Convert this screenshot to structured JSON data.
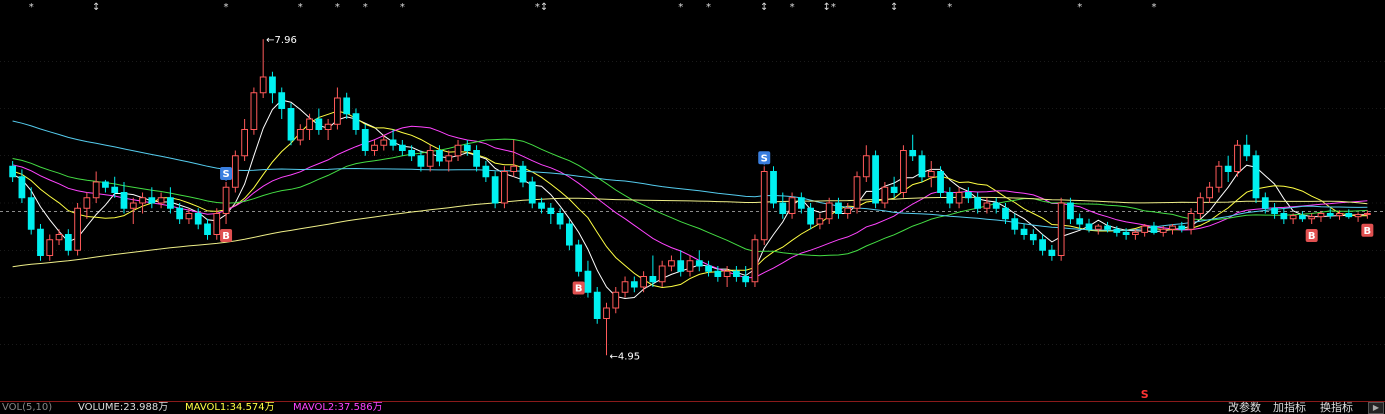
{
  "chart_data": {
    "type": "candlestick",
    "price_range": [
      4.6,
      8.2
    ],
    "reference_price": 6.32,
    "price_high_label": "7.96",
    "price_low_label": "4.95",
    "candles": [
      [
        6.75,
        6.8,
        6.6,
        6.65
      ],
      [
        6.65,
        6.72,
        6.4,
        6.45
      ],
      [
        6.45,
        6.55,
        6.1,
        6.15
      ],
      [
        6.15,
        6.2,
        5.85,
        5.9
      ],
      [
        5.9,
        6.1,
        5.85,
        6.05
      ],
      [
        6.05,
        6.15,
        6.0,
        6.1
      ],
      [
        6.1,
        6.15,
        5.9,
        5.95
      ],
      [
        5.95,
        6.4,
        5.9,
        6.35
      ],
      [
        6.35,
        6.5,
        6.25,
        6.45
      ],
      [
        6.45,
        6.7,
        6.4,
        6.6
      ],
      [
        6.6,
        6.62,
        6.5,
        6.55
      ],
      [
        6.55,
        6.65,
        6.45,
        6.5
      ],
      [
        6.5,
        6.6,
        6.3,
        6.35
      ],
      [
        6.35,
        6.45,
        6.2,
        6.4
      ],
      [
        6.4,
        6.5,
        6.3,
        6.45
      ],
      [
        6.45,
        6.55,
        6.35,
        6.4
      ],
      [
        6.4,
        6.5,
        6.35,
        6.45
      ],
      [
        6.45,
        6.55,
        6.3,
        6.35
      ],
      [
        6.35,
        6.4,
        6.2,
        6.25
      ],
      [
        6.25,
        6.35,
        6.2,
        6.3
      ],
      [
        6.3,
        6.35,
        6.15,
        6.2
      ],
      [
        6.2,
        6.25,
        6.05,
        6.1
      ],
      [
        6.1,
        6.35,
        6.05,
        6.3
      ],
      [
        6.3,
        6.6,
        6.2,
        6.55
      ],
      [
        6.55,
        6.9,
        6.5,
        6.85
      ],
      [
        6.85,
        7.2,
        6.8,
        7.1
      ],
      [
        7.1,
        7.5,
        7.05,
        7.45
      ],
      [
        7.45,
        7.96,
        7.4,
        7.6
      ],
      [
        7.6,
        7.65,
        7.35,
        7.45
      ],
      [
        7.45,
        7.5,
        7.2,
        7.3
      ],
      [
        7.3,
        7.35,
        6.95,
        7.0
      ],
      [
        7.0,
        7.15,
        6.95,
        7.1
      ],
      [
        7.1,
        7.25,
        7.0,
        7.2
      ],
      [
        7.2,
        7.3,
        7.05,
        7.1
      ],
      [
        7.1,
        7.2,
        7.0,
        7.15
      ],
      [
        7.15,
        7.5,
        7.1,
        7.4
      ],
      [
        7.4,
        7.45,
        7.2,
        7.25
      ],
      [
        7.25,
        7.3,
        7.05,
        7.1
      ],
      [
        7.1,
        7.15,
        6.85,
        6.9
      ],
      [
        6.9,
        7.0,
        6.85,
        6.95
      ],
      [
        6.95,
        7.05,
        6.9,
        7.0
      ],
      [
        7.0,
        7.1,
        6.9,
        6.95
      ],
      [
        6.95,
        7.0,
        6.85,
        6.9
      ],
      [
        6.9,
        6.95,
        6.8,
        6.85
      ],
      [
        6.85,
        6.9,
        6.7,
        6.75
      ],
      [
        6.75,
        6.95,
        6.7,
        6.9
      ],
      [
        6.9,
        6.95,
        6.75,
        6.8
      ],
      [
        6.8,
        6.9,
        6.7,
        6.85
      ],
      [
        6.85,
        7.0,
        6.8,
        6.95
      ],
      [
        6.95,
        7.0,
        6.85,
        6.9
      ],
      [
        6.9,
        6.95,
        6.7,
        6.75
      ],
      [
        6.75,
        6.8,
        6.6,
        6.65
      ],
      [
        6.65,
        6.7,
        6.35,
        6.4
      ],
      [
        6.4,
        6.75,
        6.35,
        6.7
      ],
      [
        6.7,
        7.0,
        6.65,
        6.75
      ],
      [
        6.75,
        6.8,
        6.55,
        6.6
      ],
      [
        6.6,
        6.65,
        6.35,
        6.4
      ],
      [
        6.4,
        6.45,
        6.3,
        6.35
      ],
      [
        6.35,
        6.4,
        6.2,
        6.3
      ],
      [
        6.3,
        6.35,
        6.15,
        6.2
      ],
      [
        6.2,
        6.25,
        5.95,
        6.0
      ],
      [
        6.0,
        6.05,
        5.7,
        5.75
      ],
      [
        5.75,
        5.85,
        5.5,
        5.55
      ],
      [
        5.55,
        5.6,
        5.25,
        5.3
      ],
      [
        5.3,
        5.45,
        4.95,
        5.4
      ],
      [
        5.4,
        5.6,
        5.35,
        5.55
      ],
      [
        5.55,
        5.7,
        5.5,
        5.65
      ],
      [
        5.65,
        5.7,
        5.55,
        5.6
      ],
      [
        5.6,
        5.75,
        5.55,
        5.7
      ],
      [
        5.7,
        5.9,
        5.6,
        5.65
      ],
      [
        5.65,
        5.85,
        5.6,
        5.8
      ],
      [
        5.8,
        5.9,
        5.75,
        5.85
      ],
      [
        5.85,
        5.95,
        5.7,
        5.75
      ],
      [
        5.75,
        5.9,
        5.7,
        5.85
      ],
      [
        5.85,
        5.95,
        5.75,
        5.8
      ],
      [
        5.8,
        5.85,
        5.7,
        5.75
      ],
      [
        5.75,
        5.8,
        5.65,
        5.7
      ],
      [
        5.7,
        5.8,
        5.6,
        5.75
      ],
      [
        5.75,
        5.8,
        5.65,
        5.7
      ],
      [
        5.7,
        5.8,
        5.6,
        5.65
      ],
      [
        5.65,
        6.1,
        5.6,
        6.05
      ],
      [
        6.05,
        6.75,
        6.0,
        6.7
      ],
      [
        6.7,
        6.75,
        6.35,
        6.4
      ],
      [
        6.4,
        6.5,
        6.25,
        6.3
      ],
      [
        6.3,
        6.5,
        6.25,
        6.45
      ],
      [
        6.45,
        6.5,
        6.3,
        6.35
      ],
      [
        6.35,
        6.4,
        6.15,
        6.2
      ],
      [
        6.2,
        6.3,
        6.15,
        6.25
      ],
      [
        6.25,
        6.45,
        6.2,
        6.4
      ],
      [
        6.4,
        6.45,
        6.25,
        6.3
      ],
      [
        6.3,
        6.4,
        6.25,
        6.35
      ],
      [
        6.35,
        6.7,
        6.3,
        6.65
      ],
      [
        6.65,
        6.95,
        6.6,
        6.85
      ],
      [
        6.85,
        6.9,
        6.35,
        6.4
      ],
      [
        6.4,
        6.6,
        6.35,
        6.55
      ],
      [
        6.55,
        6.65,
        6.45,
        6.5
      ],
      [
        6.5,
        6.95,
        6.45,
        6.9
      ],
      [
        6.9,
        7.05,
        6.8,
        6.85
      ],
      [
        6.85,
        6.9,
        6.6,
        6.65
      ],
      [
        6.65,
        6.8,
        6.55,
        6.7
      ],
      [
        6.7,
        6.75,
        6.45,
        6.5
      ],
      [
        6.5,
        6.55,
        6.35,
        6.4
      ],
      [
        6.4,
        6.55,
        6.35,
        6.5
      ],
      [
        6.5,
        6.55,
        6.4,
        6.45
      ],
      [
        6.45,
        6.5,
        6.3,
        6.35
      ],
      [
        6.35,
        6.45,
        6.3,
        6.4
      ],
      [
        6.4,
        6.45,
        6.3,
        6.35
      ],
      [
        6.35,
        6.4,
        6.2,
        6.25
      ],
      [
        6.25,
        6.3,
        6.1,
        6.15
      ],
      [
        6.15,
        6.2,
        6.05,
        6.1
      ],
      [
        6.1,
        6.15,
        6.0,
        6.05
      ],
      [
        6.05,
        6.1,
        5.9,
        5.95
      ],
      [
        5.95,
        6.0,
        5.85,
        5.9
      ],
      [
        5.9,
        6.45,
        5.85,
        6.4
      ],
      [
        6.4,
        6.45,
        6.2,
        6.25
      ],
      [
        6.25,
        6.3,
        6.15,
        6.2
      ],
      [
        6.2,
        6.25,
        6.12,
        6.15
      ],
      [
        6.15,
        6.2,
        6.1,
        6.18
      ],
      [
        6.18,
        6.22,
        6.12,
        6.15
      ],
      [
        6.15,
        6.18,
        6.08,
        6.12
      ],
      [
        6.12,
        6.16,
        6.05,
        6.1
      ],
      [
        6.1,
        6.15,
        6.05,
        6.12
      ],
      [
        6.12,
        6.2,
        6.08,
        6.18
      ],
      [
        6.18,
        6.22,
        6.1,
        6.12
      ],
      [
        6.12,
        6.18,
        6.08,
        6.15
      ],
      [
        6.15,
        6.2,
        6.1,
        6.18
      ],
      [
        6.18,
        6.22,
        6.12,
        6.15
      ],
      [
        6.15,
        6.35,
        6.1,
        6.3
      ],
      [
        6.3,
        6.5,
        6.25,
        6.45
      ],
      [
        6.45,
        6.6,
        6.4,
        6.55
      ],
      [
        6.55,
        6.8,
        6.5,
        6.75
      ],
      [
        6.75,
        6.85,
        6.6,
        6.7
      ],
      [
        6.7,
        7.0,
        6.65,
        6.95
      ],
      [
        6.95,
        7.05,
        6.8,
        6.85
      ],
      [
        6.85,
        6.9,
        6.4,
        6.45
      ],
      [
        6.45,
        6.5,
        6.3,
        6.35
      ],
      [
        6.35,
        6.4,
        6.25,
        6.3
      ],
      [
        6.3,
        6.35,
        6.2,
        6.25
      ],
      [
        6.25,
        6.3,
        6.2,
        6.28
      ],
      [
        6.28,
        6.32,
        6.22,
        6.25
      ],
      [
        6.25,
        6.3,
        6.2,
        6.27
      ],
      [
        6.27,
        6.32,
        6.22,
        6.3
      ],
      [
        6.3,
        6.35,
        6.25,
        6.28
      ],
      [
        6.28,
        6.33,
        6.24,
        6.3
      ],
      [
        6.3,
        6.34,
        6.25,
        6.27
      ],
      [
        6.27,
        6.31,
        6.22,
        6.29
      ],
      [
        6.29,
        6.33,
        6.25,
        6.3
      ]
    ],
    "moving_averages": [
      {
        "color": "#ffffff",
        "period": 5
      },
      {
        "color": "#ffff44",
        "period": 10
      },
      {
        "color": "#ff44ff",
        "period": 20
      },
      {
        "color": "#44dd44",
        "period": 30
      },
      {
        "color": "#55ccee",
        "period": 60
      },
      {
        "color": "#eeee88",
        "period": 120
      }
    ],
    "markers": [
      {
        "label": "S",
        "index": 23,
        "side": "above",
        "color": "#3a7fe0"
      },
      {
        "label": "B",
        "index": 23,
        "side": "below",
        "color": "#e05050"
      },
      {
        "label": "B",
        "index": 61,
        "side": "below",
        "color": "#e05050"
      },
      {
        "label": "S",
        "index": 81,
        "side": "above",
        "color": "#3a7fe0"
      },
      {
        "label": "B",
        "index": 140,
        "side": "below",
        "color": "#e05050"
      },
      {
        "label": "B",
        "index": 146,
        "side": "below",
        "color": "#e05050"
      }
    ],
    "top_markers": [
      "*",
      "↕",
      "*",
      "*",
      "*",
      "*",
      "*",
      "*↕",
      "*",
      "*",
      "↕",
      "*",
      "↕*",
      "↕",
      "*",
      "*",
      "*"
    ],
    "top_marker_indices": [
      2,
      9,
      23,
      31,
      35,
      38,
      42,
      57,
      72,
      75,
      81,
      84,
      88,
      95,
      101,
      115,
      123
    ],
    "bottom_marker": "S",
    "colors": {
      "up": "#ff5a5a",
      "down": "#00f0f0",
      "background": "#000000",
      "grid": "#555555"
    }
  },
  "footer": {
    "vol_label": "VOL(5,10)",
    "volume_label": "VOLUME:23.988万",
    "mavol1_label": "MAVOL1:34.574万",
    "mavol2_label": "MAVOL2:37.586万",
    "btn_params": "改参数",
    "btn_add": "加指标",
    "btn_swap": "换指标"
  }
}
